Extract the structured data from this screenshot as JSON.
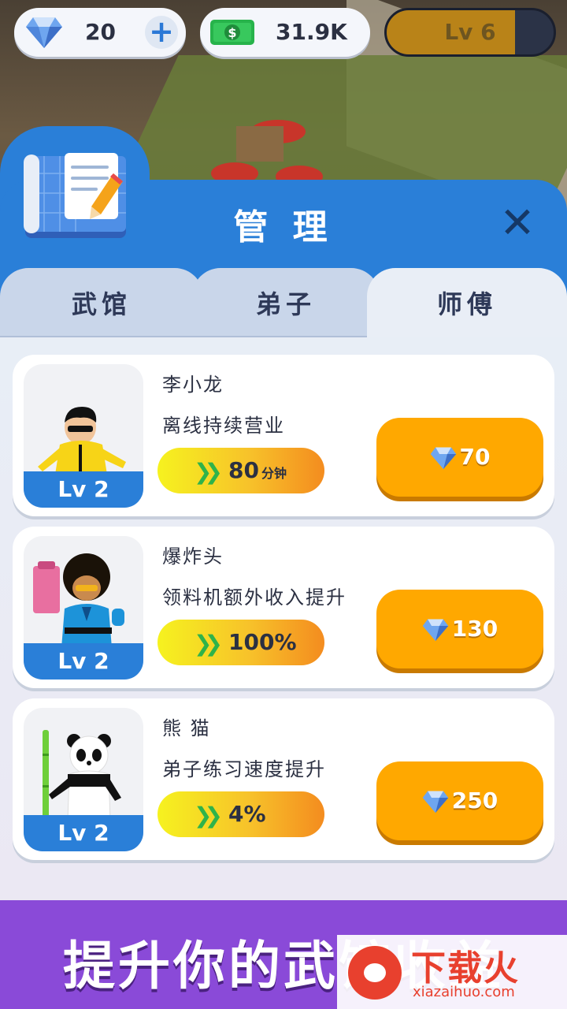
{
  "currency": {
    "gems": "20",
    "plus": "+",
    "cash": "31.9K",
    "cash_icon": "dollar-bill-icon",
    "gem_icon": "diamond-icon"
  },
  "level": {
    "label": "Lv 6",
    "progress": 0.77
  },
  "panel": {
    "title": "管 理",
    "close": "✕"
  },
  "tabs": [
    {
      "label": "武馆",
      "active": false
    },
    {
      "label": "弟子",
      "active": false
    },
    {
      "label": "师傅",
      "active": true
    }
  ],
  "masters": [
    {
      "name": "李小龙",
      "desc": "离线持续营业",
      "stat": "80",
      "unit": "分钟",
      "level": "Lv 2",
      "price": "70"
    },
    {
      "name": "爆炸头",
      "desc": "领料机额外收入提升",
      "stat": "100%",
      "unit": "",
      "level": "Lv 2",
      "price": "130"
    },
    {
      "name": "熊 猫",
      "desc": "弟子练习速度提升",
      "stat": "4%",
      "unit": "",
      "level": "Lv 2",
      "price": "250"
    }
  ],
  "banner": {
    "text": "提升你的武馆收益"
  },
  "watermark": {
    "brand": "下载火",
    "url": "xiazaihuo.com"
  }
}
